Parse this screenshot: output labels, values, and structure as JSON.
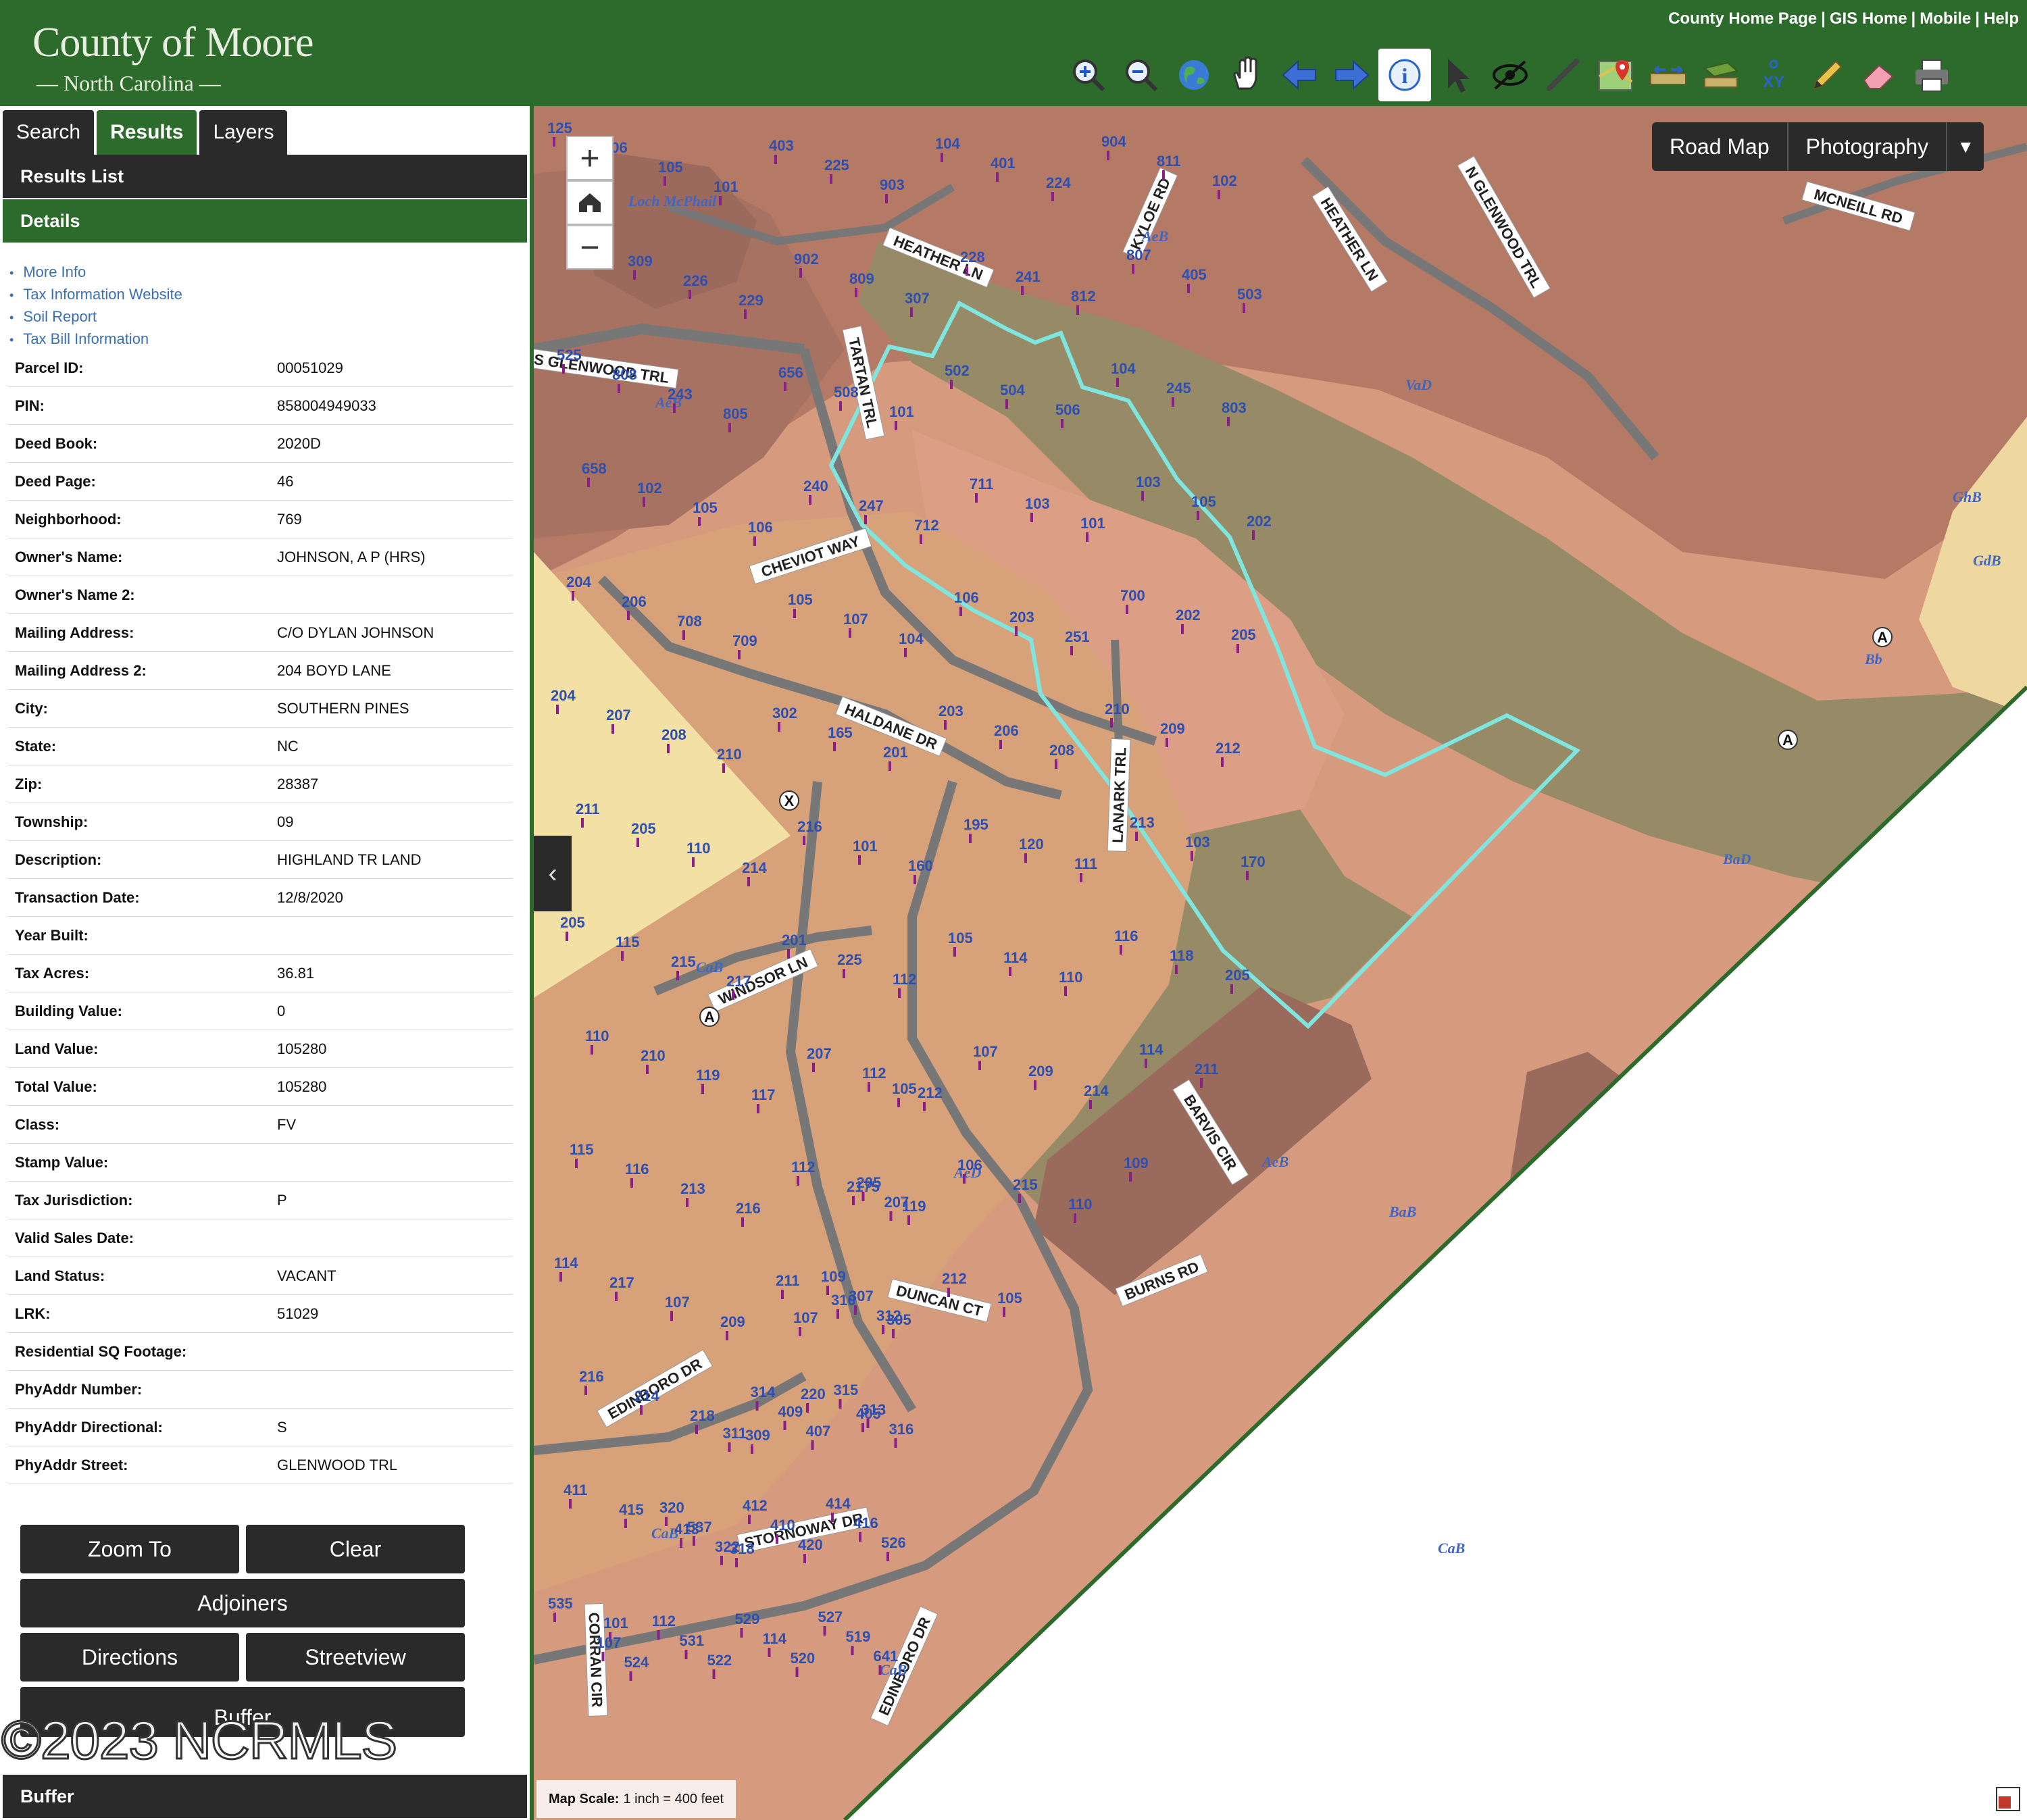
{
  "header": {
    "logo_line1": "County of Moore",
    "logo_line2": "— North Carolina —",
    "links": [
      "County Home Page",
      "GIS Home",
      "Mobile",
      "Help"
    ]
  },
  "toolbar": {
    "tools": [
      "zoom-in-icon",
      "zoom-out-icon",
      "globe-icon",
      "pan-hand-icon",
      "back-arrow-icon",
      "forward-arrow-icon",
      "identify-info-icon",
      "select-arrow-icon",
      "hide-layer-icon",
      "measure-line-icon",
      "map-marker-icon",
      "measure-distance-icon",
      "measure-area-icon",
      "xy-coordinate-icon",
      "pencil-icon",
      "eraser-icon",
      "print-icon"
    ],
    "active_tool": "identify-info-icon"
  },
  "tabs": [
    {
      "label": "Search"
    },
    {
      "label": "Results"
    },
    {
      "label": "Layers"
    }
  ],
  "active_tab": "Results",
  "panel": {
    "results_list": "Results List",
    "details": "Details",
    "buffer": "Buffer"
  },
  "links": [
    {
      "label": "More Info"
    },
    {
      "label": "Tax Information Website"
    },
    {
      "label": "Soil Report"
    },
    {
      "label": "Tax Bill Information"
    }
  ],
  "details": [
    {
      "key": "Parcel ID:",
      "value": "00051029"
    },
    {
      "key": "PIN:",
      "value": "858004949033"
    },
    {
      "key": "Deed Book:",
      "value": "2020D"
    },
    {
      "key": "Deed Page:",
      "value": "46"
    },
    {
      "key": "Neighborhood:",
      "value": "769"
    },
    {
      "key": "Owner's Name:",
      "value": "JOHNSON, A P (HRS)"
    },
    {
      "key": "Owner's Name 2:",
      "value": ""
    },
    {
      "key": "Mailing Address:",
      "value": "C/O DYLAN JOHNSON"
    },
    {
      "key": "Mailing Address 2:",
      "value": "204 BOYD LANE"
    },
    {
      "key": "City:",
      "value": "SOUTHERN PINES"
    },
    {
      "key": "State:",
      "value": "NC"
    },
    {
      "key": "Zip:",
      "value": "28387"
    },
    {
      "key": "Township:",
      "value": "09"
    },
    {
      "key": "Description:",
      "value": "HIGHLAND TR LAND"
    },
    {
      "key": "Transaction Date:",
      "value": "12/8/2020"
    },
    {
      "key": "Year Built:",
      "value": ""
    },
    {
      "key": "Tax Acres:",
      "value": "36.81"
    },
    {
      "key": "Building Value:",
      "value": "0"
    },
    {
      "key": "Land Value:",
      "value": "105280"
    },
    {
      "key": "Total Value:",
      "value": "105280"
    },
    {
      "key": "Class:",
      "value": "FV"
    },
    {
      "key": "Stamp Value:",
      "value": ""
    },
    {
      "key": "Tax Jurisdiction:",
      "value": "P"
    },
    {
      "key": "Valid Sales Date:",
      "value": ""
    },
    {
      "key": "Land Status:",
      "value": "VACANT"
    },
    {
      "key": "LRK:",
      "value": "51029"
    },
    {
      "key": "Residential SQ Footage:",
      "value": ""
    },
    {
      "key": "PhyAddr Number:",
      "value": ""
    },
    {
      "key": "PhyAddr Directional:",
      "value": "S"
    },
    {
      "key": "PhyAddr Street:",
      "value": "GLENWOOD TRL"
    }
  ],
  "buttons": {
    "zoom_to": "Zoom To",
    "clear": "Clear",
    "adjoiners": "Adjoiners",
    "directions": "Directions",
    "streetview": "Streetview",
    "buffer": "Buffer"
  },
  "watermark": "©2023 NCRMLS",
  "map": {
    "zoom_in": "+",
    "zoom_out": "−",
    "basemaps": [
      "Road Map",
      "Photography"
    ],
    "scale_label": "Map Scale:",
    "scale_value": "1 inch = 400 feet",
    "water_label": "Loch McPhail",
    "selection_color": "#7fe6df",
    "roads": [
      "S GLENWOOD TRL",
      "TARTAN TRL",
      "HEATHER LN",
      "KYLOE RD",
      "HEATHER LN",
      "N GLENWOOD TRL",
      "MCNEILL RD",
      "CHEVIOT WAY",
      "HALDANE DR",
      "LANARK TRL",
      "WINDSOR LN",
      "BARVIS CIR",
      "BURNS RD",
      "DUNCAN CT",
      "EDINBORO DR",
      "STORNOWAY DR",
      "CORRAN CIR",
      "EDINBORO DR"
    ],
    "soil_units": [
      "AeB",
      "AeB",
      "VaD",
      "GhB",
      "GdB",
      "Bb",
      "BaD",
      "AeD",
      "AeB",
      "BaB",
      "CaB",
      "CaB",
      "CaB",
      "CaB"
    ],
    "lot_numbers": [
      "125",
      "106",
      "105",
      "101",
      "403",
      "225",
      "903",
      "104",
      "401",
      "224",
      "904",
      "811",
      "102",
      "100",
      "309",
      "226",
      "229",
      "902",
      "809",
      "307",
      "228",
      "241",
      "812",
      "807",
      "405",
      "503",
      "525",
      "808",
      "243",
      "805",
      "656",
      "508",
      "101",
      "502",
      "504",
      "506",
      "104",
      "245",
      "803",
      "658",
      "102",
      "105",
      "106",
      "240",
      "247",
      "712",
      "711",
      "103",
      "101",
      "103",
      "105",
      "202",
      "204",
      "206",
      "708",
      "709",
      "105",
      "107",
      "104",
      "106",
      "203",
      "251",
      "700",
      "202",
      "205",
      "204",
      "207",
      "208",
      "210",
      "302",
      "165",
      "201",
      "203",
      "206",
      "208",
      "210",
      "209",
      "212",
      "211",
      "205",
      "110",
      "214",
      "216",
      "101",
      "160",
      "195",
      "120",
      "111",
      "213",
      "103",
      "170",
      "205",
      "115",
      "215",
      "217",
      "201",
      "225",
      "112",
      "105",
      "114",
      "110",
      "116",
      "118",
      "205",
      "110",
      "210",
      "119",
      "117",
      "207",
      "112",
      "212",
      "107",
      "209",
      "214",
      "114",
      "211",
      "105",
      "115",
      "116",
      "213",
      "216",
      "112",
      "2175",
      "119",
      "106",
      "215",
      "110",
      "109",
      "205",
      "207",
      "114",
      "217",
      "107",
      "209",
      "211",
      "310",
      "305",
      "212",
      "105",
      "107",
      "109",
      "307",
      "312",
      "216",
      "214",
      "218",
      "309",
      "220",
      "405",
      "311",
      "314",
      "409",
      "407",
      "315",
      "313",
      "316",
      "411",
      "415",
      "413",
      "318",
      "320",
      "537",
      "322",
      "412",
      "410",
      "420",
      "414",
      "416",
      "526",
      "535",
      "101",
      "107",
      "524",
      "112",
      "531",
      "522",
      "529",
      "114",
      "520",
      "527",
      "519",
      "641"
    ],
    "markers": [
      "A",
      "A",
      "A",
      "X"
    ]
  }
}
